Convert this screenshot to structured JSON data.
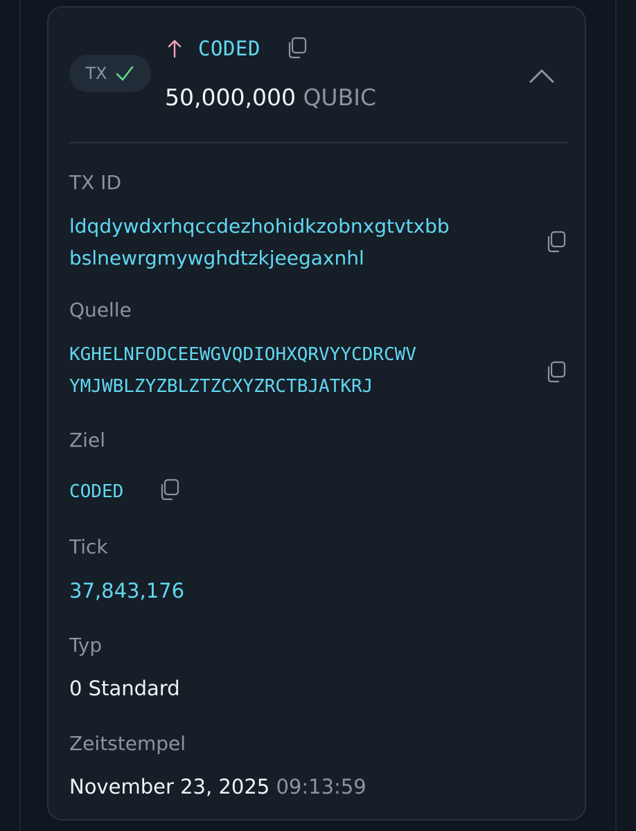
{
  "header": {
    "badge_label": "TX",
    "badge_status_icon": "check-icon",
    "direction_icon": "arrow-up-icon",
    "title": "CODED",
    "amount_value": "50,000,000",
    "amount_unit": "QUBIC",
    "collapse_icon": "chevron-up-icon"
  },
  "fields": {
    "tx_id": {
      "label": "TX ID",
      "line1": "ldqdywdxrhqccdezhohidkzobnxgtvtxbb",
      "line2": "bslnewrgmywghdtzkjeegaxnhl"
    },
    "source": {
      "label": "Quelle",
      "line1": "KGHELNFODCEEWGVQDIOHXQRVYYCDRCWV",
      "line2": "YMJWBLZYZBLZTZCXYZRCTBJATKRJ"
    },
    "destination": {
      "label": "Ziel",
      "value": "CODED"
    },
    "tick": {
      "label": "Tick",
      "value": "37,843,176"
    },
    "type": {
      "label": "Typ",
      "value": "0 Standard"
    },
    "timestamp": {
      "label": "Zeitstempel",
      "date": "November 23, 2025",
      "time": "09:13:59"
    }
  },
  "colors": {
    "background": "#101720",
    "card": "#161e28",
    "accent_cyan": "#61d8f0",
    "muted": "#8a94a2",
    "success_green": "#5fdc87",
    "arrow_pink": "#f0a6bd"
  }
}
